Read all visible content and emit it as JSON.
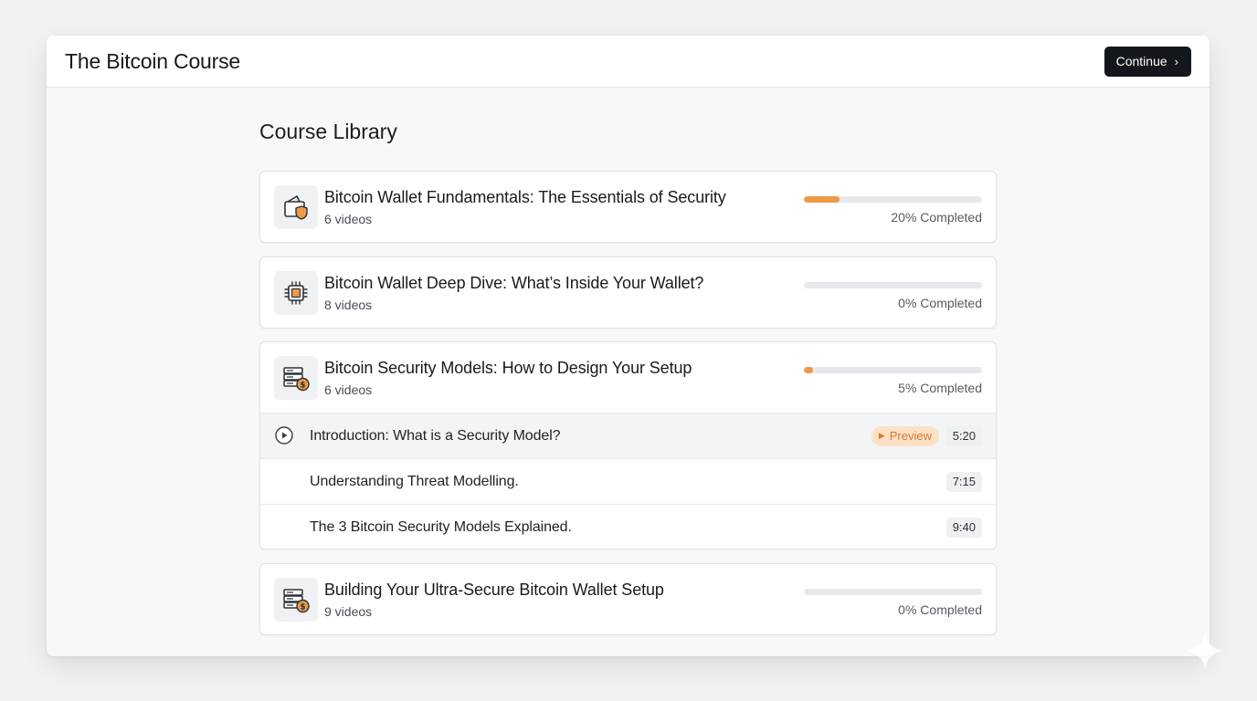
{
  "app": {
    "title": "The Bitcoin Course",
    "continue_label": "Continue"
  },
  "library": {
    "title": "Course Library",
    "courses": [
      {
        "title": "Bitcoin Wallet Fundamentals: The Essentials of Security",
        "videos": "6 videos",
        "progress_percent": 20,
        "progress_label": "20% Completed",
        "icon": "wallet-shield-icon"
      },
      {
        "title": "Bitcoin Wallet Deep Dive: What’s Inside Your Wallet?",
        "videos": "8 videos",
        "progress_percent": 0,
        "progress_label": "0% Completed",
        "icon": "chip-icon"
      },
      {
        "title": "Bitcoin Security Models: How to Design Your Setup",
        "videos": "6 videos",
        "progress_percent": 5,
        "progress_label": "5% Completed",
        "icon": "server-coin-icon",
        "lessons": [
          {
            "title": "Introduction: What is a Security Model?",
            "duration": "5:20",
            "preview": "Preview"
          },
          {
            "title": "Understanding Threat Modelling.",
            "duration": "7:15"
          },
          {
            "title": "The 3 Bitcoin Security Models Explained.",
            "duration": "9:40"
          }
        ]
      },
      {
        "title": "Building Your Ultra-Secure Bitcoin Wallet Setup",
        "videos": "9 videos",
        "progress_percent": 0,
        "progress_label": "0% Completed",
        "icon": "server-coin-icon"
      }
    ]
  },
  "colors": {
    "accent": "#ec9a48",
    "button_bg": "#13171b",
    "preview_bg": "#fde1c7",
    "preview_text": "#d9782c"
  }
}
